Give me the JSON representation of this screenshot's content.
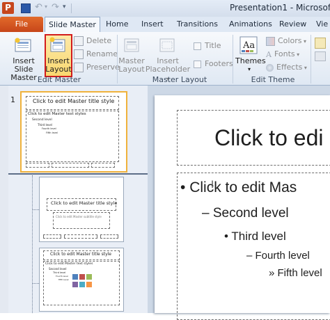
{
  "window": {
    "title": "Presentation1 - Microsof"
  },
  "tabs": [
    {
      "label": "File"
    },
    {
      "label": "Slide Master"
    },
    {
      "label": "Home"
    },
    {
      "label": "Insert"
    },
    {
      "label": "Transitions"
    },
    {
      "label": "Animations"
    },
    {
      "label": "Review"
    },
    {
      "label": "Vie"
    }
  ],
  "ribbon": {
    "edit_master": {
      "label": "Edit Master",
      "insert_slide_master": [
        "Insert Slide",
        "Master"
      ],
      "insert_layout": [
        "Insert",
        "Layout"
      ],
      "delete": "Delete",
      "rename": "Rename",
      "preserve": "Preserve"
    },
    "master_layout": {
      "label": "Master Layout",
      "master_layout_btn": [
        "Master",
        "Layout"
      ],
      "insert_placeholder": [
        "Insert",
        "Placeholder"
      ],
      "title": "Title",
      "footers": "Footers"
    },
    "edit_theme": {
      "label": "Edit Theme",
      "themes": "Themes",
      "colors": "Colors",
      "fonts": "Fonts",
      "effects": "Effects"
    }
  },
  "thumbnails": {
    "slide_number": "1",
    "master_title": "Click to edit Master title style",
    "master_text": "Click to edit Master text styles",
    "levels": [
      "Second level",
      "Third level",
      "Fourth level",
      "Fifth level"
    ],
    "layout1_title": "Click to edit Master title style",
    "layout1_subtitle": "Click to edit Master subtitle style",
    "layout2_title": "Click to edit Master title style",
    "layout2_text": "Click to edit Master text styles"
  },
  "slide": {
    "title": "Click to edi",
    "body": [
      "Click to edit Mas",
      "Second level",
      "Third level",
      "Fourth level",
      "Fifth level"
    ]
  }
}
